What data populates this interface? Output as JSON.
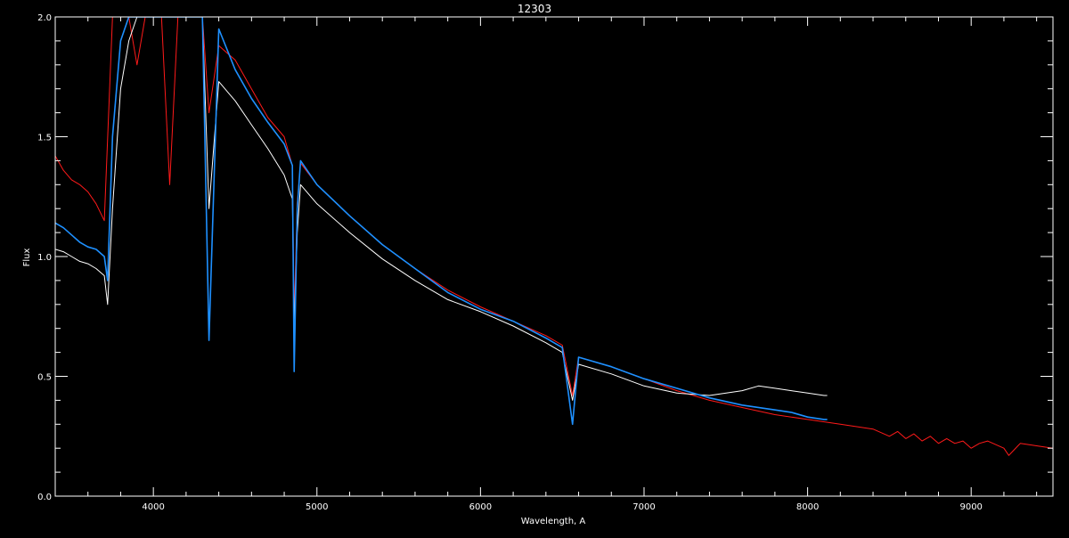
{
  "chart_data": {
    "type": "line",
    "title": "12303",
    "xlabel": "Wavelength, A",
    "ylabel": "Flux",
    "xlim": [
      3400,
      9500
    ],
    "ylim": [
      0.0,
      2.0
    ],
    "x_ticks": [
      4000,
      5000,
      6000,
      7000,
      8000,
      9000
    ],
    "y_ticks": [
      0.0,
      0.5,
      1.0,
      1.5,
      2.0
    ],
    "y_tick_labels": [
      "0.0",
      "0.5",
      "1.0",
      "1.5",
      "2.0"
    ],
    "grid": false,
    "background": "#000000",
    "axis_color": "#ffffff",
    "series": [
      {
        "color": "#ff1a1a",
        "x": [
          3400,
          3450,
          3500,
          3550,
          3600,
          3650,
          3700,
          3750,
          3800,
          3850,
          3900,
          3950,
          4000,
          4050,
          4100,
          4150,
          4200,
          4300,
          4340,
          4400,
          4500,
          4600,
          4700,
          4800,
          4850,
          4861,
          4880,
          4900,
          5000,
          5200,
          5400,
          5600,
          5800,
          6000,
          6200,
          6400,
          6500,
          6563,
          6600,
          6800,
          7000,
          7200,
          7400,
          7600,
          7800,
          8000,
          8200,
          8400,
          8500,
          8550,
          8600,
          8650,
          8700,
          8750,
          8800,
          8850,
          8900,
          8950,
          9000,
          9050,
          9100,
          9200,
          9230,
          9300,
          9400,
          9500
        ],
        "y": [
          1.42,
          1.36,
          1.32,
          1.3,
          1.27,
          1.22,
          1.15,
          2.0,
          2.0,
          2.0,
          1.8,
          2.0,
          2.0,
          2.0,
          1.3,
          2.0,
          2.0,
          2.0,
          1.6,
          1.88,
          1.82,
          1.7,
          1.58,
          1.5,
          1.38,
          0.75,
          1.22,
          1.39,
          1.3,
          1.17,
          1.05,
          0.95,
          0.86,
          0.79,
          0.73,
          0.67,
          0.63,
          0.42,
          0.58,
          0.54,
          0.49,
          0.44,
          0.4,
          0.37,
          0.34,
          0.32,
          0.3,
          0.28,
          0.25,
          0.27,
          0.24,
          0.26,
          0.23,
          0.25,
          0.22,
          0.24,
          0.22,
          0.23,
          0.2,
          0.22,
          0.23,
          0.2,
          0.17,
          0.22,
          0.21,
          0.2
        ]
      },
      {
        "color": "#ffffff",
        "x": [
          3400,
          3450,
          3500,
          3550,
          3600,
          3650,
          3700,
          3720,
          3750,
          3800,
          3850,
          3900,
          3970,
          4000,
          4102,
          4200,
          4300,
          4340,
          4400,
          4500,
          4600,
          4700,
          4800,
          4850,
          4861,
          4880,
          4900,
          5000,
          5200,
          5400,
          5600,
          5800,
          6000,
          6200,
          6400,
          6500,
          6563,
          6600,
          6800,
          7000,
          7200,
          7400,
          7600,
          7700,
          7800,
          7900,
          8000,
          8100,
          8120
        ],
        "y": [
          1.03,
          1.02,
          1.0,
          0.98,
          0.97,
          0.95,
          0.92,
          0.8,
          1.2,
          1.7,
          1.9,
          2.0,
          2.0,
          2.0,
          2.0,
          2.0,
          2.0,
          1.2,
          1.73,
          1.65,
          1.55,
          1.45,
          1.34,
          1.24,
          0.7,
          1.1,
          1.3,
          1.22,
          1.1,
          0.99,
          0.9,
          0.82,
          0.77,
          0.71,
          0.64,
          0.6,
          0.4,
          0.55,
          0.51,
          0.46,
          0.43,
          0.42,
          0.44,
          0.46,
          0.45,
          0.44,
          0.43,
          0.42,
          0.42
        ]
      },
      {
        "color": "#1e90ff",
        "x": [
          3400,
          3450,
          3500,
          3550,
          3600,
          3650,
          3700,
          3720,
          3750,
          3800,
          3850,
          3900,
          3970,
          4000,
          4102,
          4200,
          4300,
          4340,
          4400,
          4500,
          4600,
          4700,
          4800,
          4850,
          4861,
          4880,
          4900,
          5000,
          5200,
          5400,
          5600,
          5800,
          6000,
          6200,
          6400,
          6500,
          6563,
          6600,
          6800,
          7000,
          7200,
          7400,
          7600,
          7800,
          7900,
          8000,
          8100,
          8120
        ],
        "y": [
          1.14,
          1.12,
          1.09,
          1.06,
          1.04,
          1.03,
          1.0,
          0.9,
          1.5,
          1.9,
          2.0,
          2.0,
          2.0,
          2.0,
          2.0,
          2.0,
          2.0,
          0.65,
          1.95,
          1.78,
          1.66,
          1.56,
          1.47,
          1.38,
          0.52,
          1.2,
          1.4,
          1.3,
          1.17,
          1.05,
          0.95,
          0.85,
          0.78,
          0.73,
          0.66,
          0.62,
          0.3,
          0.58,
          0.54,
          0.49,
          0.45,
          0.41,
          0.38,
          0.36,
          0.35,
          0.33,
          0.32,
          0.32
        ]
      }
    ]
  }
}
